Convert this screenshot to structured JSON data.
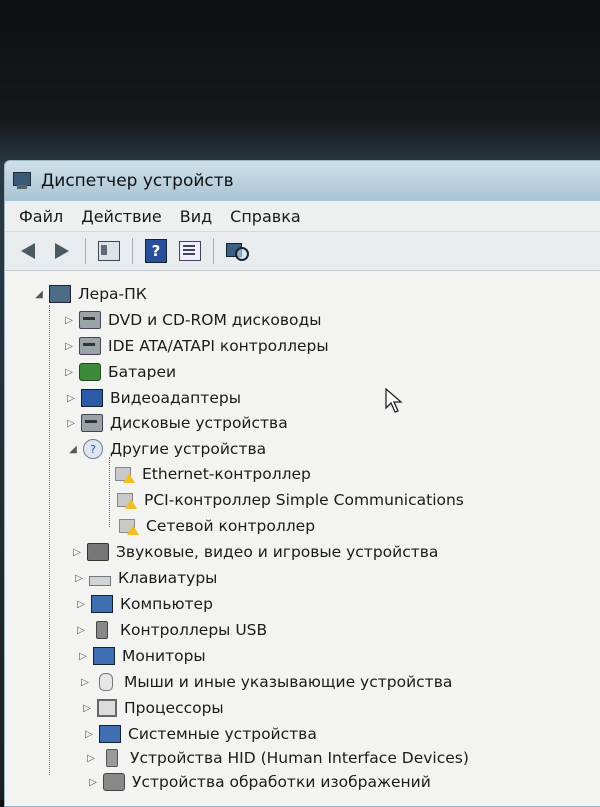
{
  "window": {
    "title": "Диспетчер устройств"
  },
  "menu": [
    "Файл",
    "Действие",
    "Вид",
    "Справка"
  ],
  "toolbar": {
    "buttons": [
      "back-arrow-icon",
      "forward-arrow-icon",
      "show-hide-console-tree-icon",
      "help-icon",
      "properties-icon",
      "scan-hardware-icon"
    ]
  },
  "tree": {
    "root": "Лера-ПК",
    "categories": [
      "DVD и CD-ROM дисководы",
      "IDE ATA/ATAPI контроллеры",
      "Батареи",
      "Видеоадаптеры",
      "Дисковые устройства",
      "Другие устройства",
      "Звуковые, видео и игровые устройства",
      "Клавиатуры",
      "Компьютер",
      "Контроллеры USB",
      "Мониторы",
      "Мыши и иные указывающие устройства",
      "Процессоры",
      "Системные устройства",
      "Устройства HID (Human Interface Devices)",
      "Устройства обработки изображений"
    ],
    "other_devices": [
      "Ethernet-контроллер",
      "PCI-контроллер Simple Communications",
      "Сетевой контроллер"
    ]
  }
}
